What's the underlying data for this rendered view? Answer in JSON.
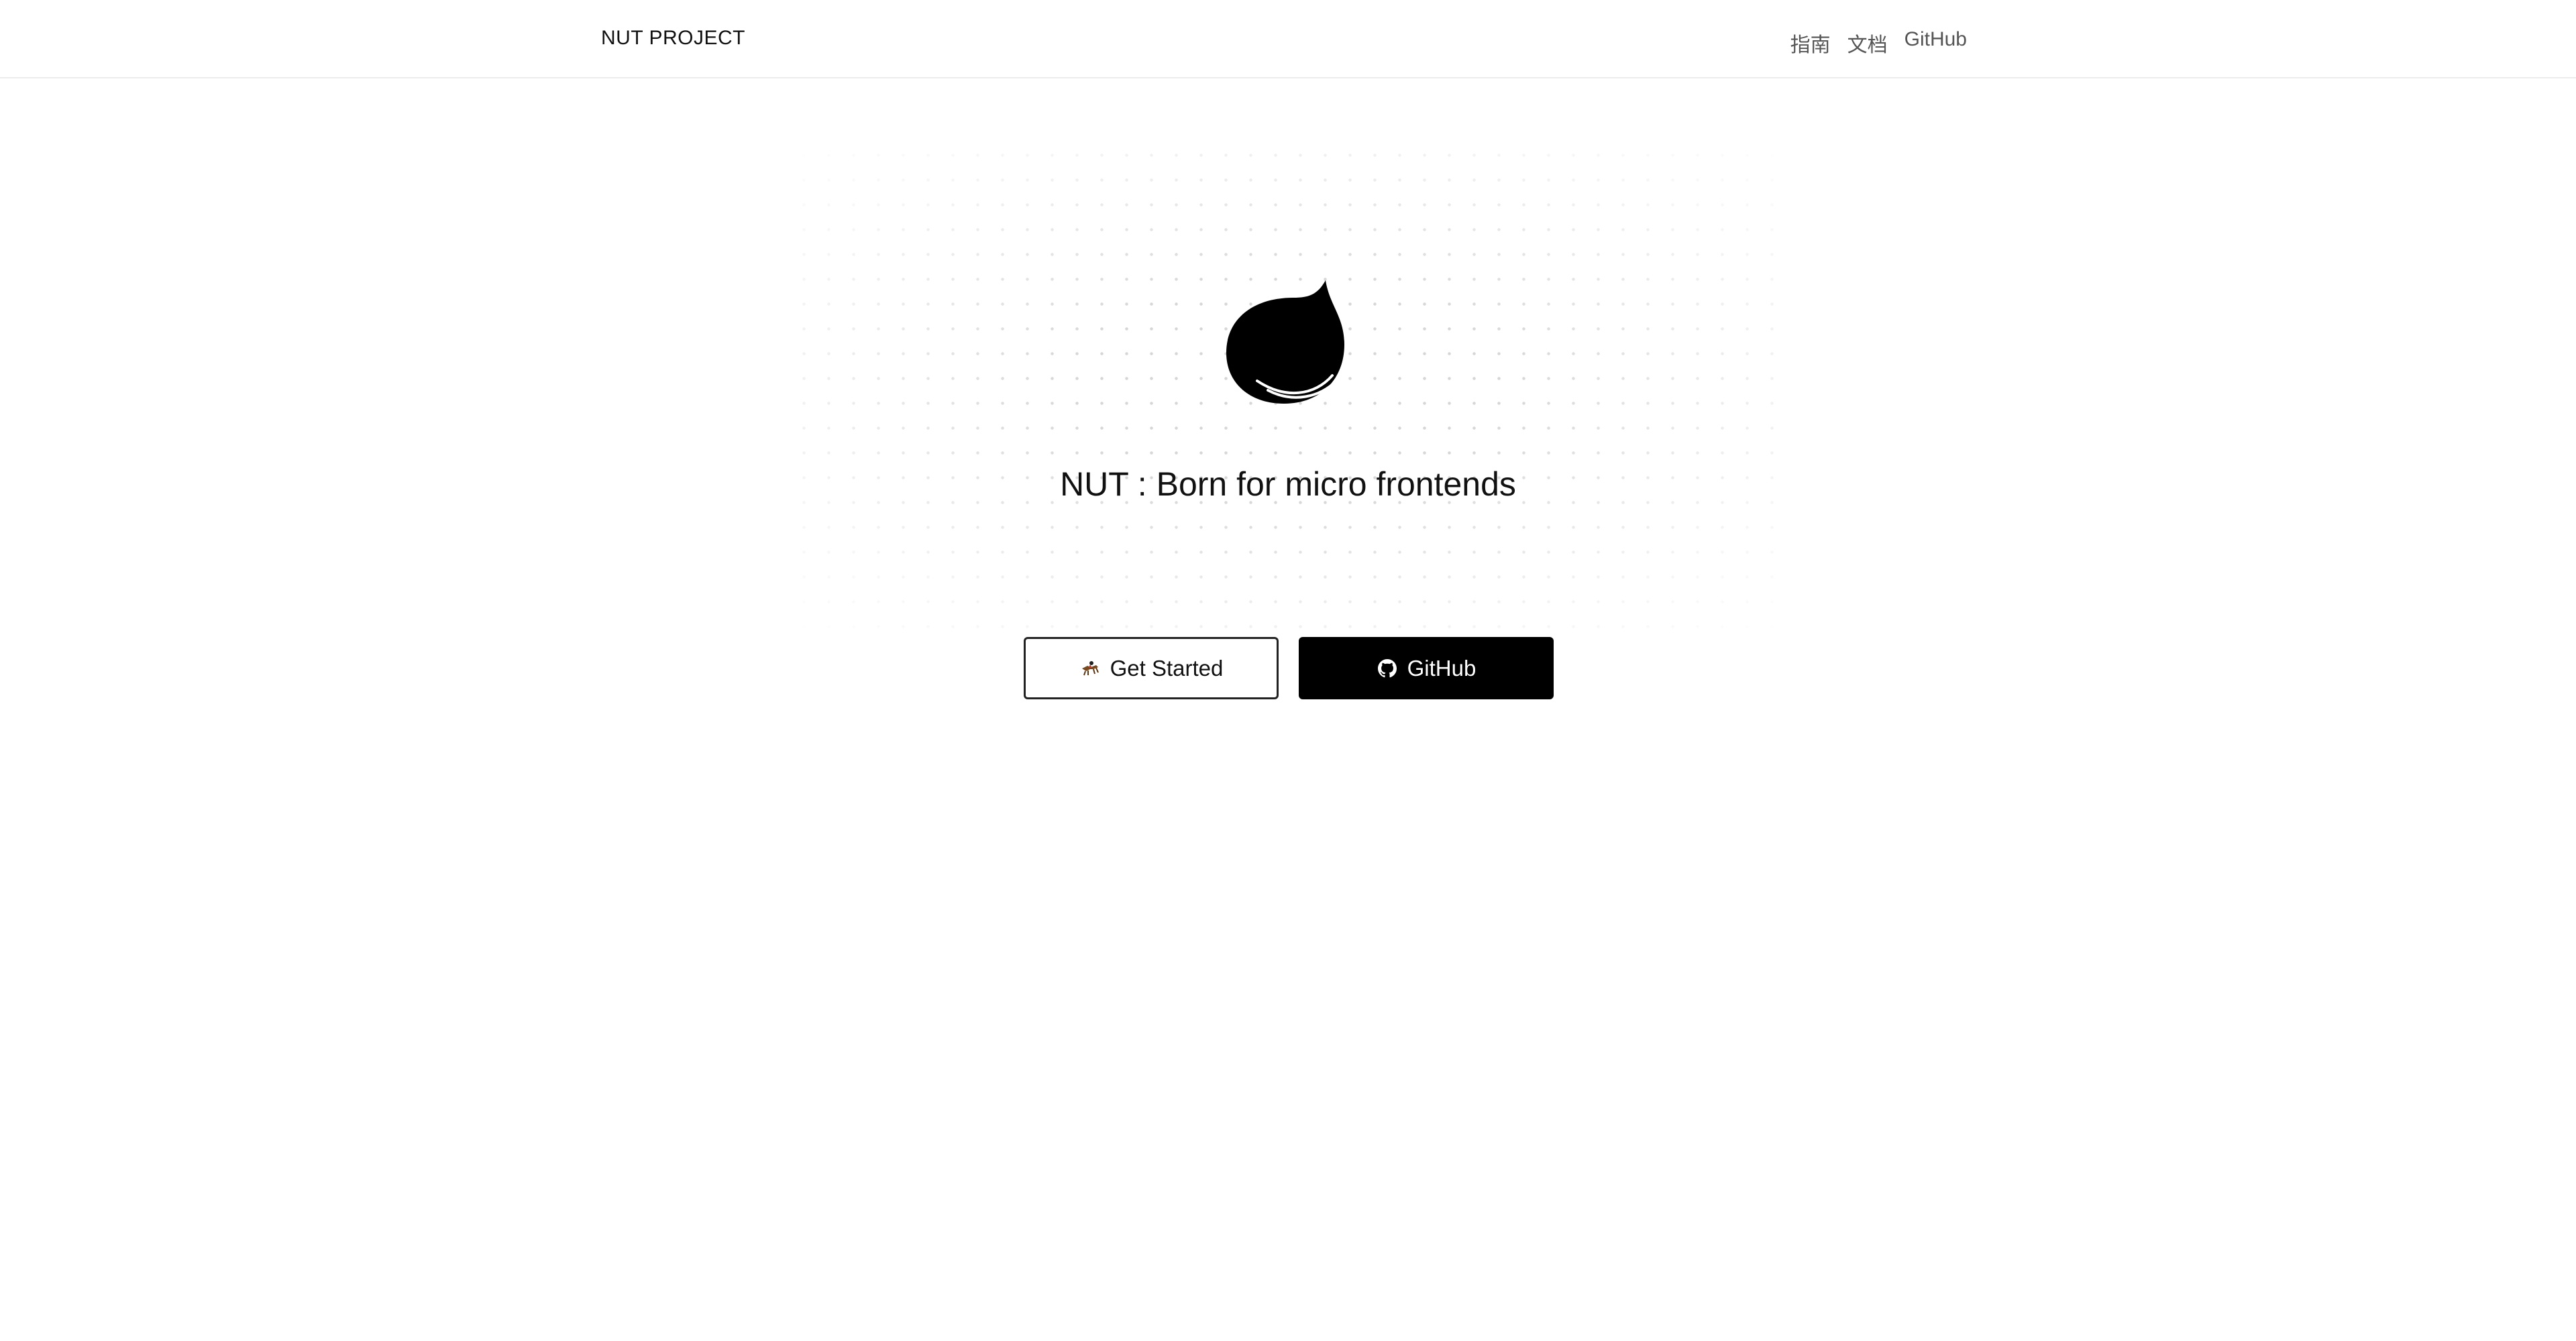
{
  "header": {
    "brand": "NUT PROJECT",
    "nav": [
      {
        "label": "指南",
        "icon": null
      },
      {
        "label": "文档",
        "icon": null
      },
      {
        "label": "GitHub",
        "icon": null
      }
    ]
  },
  "hero": {
    "logo_icon": "nut-leaf-logo-icon",
    "tagline": "NUT : Born for micro frontends",
    "buttons": {
      "get_started": {
        "label": "Get Started",
        "icon": "rider-icon"
      },
      "github": {
        "label": "GitHub",
        "icon": "github-icon"
      }
    }
  },
  "colors": {
    "primary": "#000000",
    "background": "#ffffff",
    "nav_text": "#555555",
    "grid_dot": "#d6d6d6"
  }
}
